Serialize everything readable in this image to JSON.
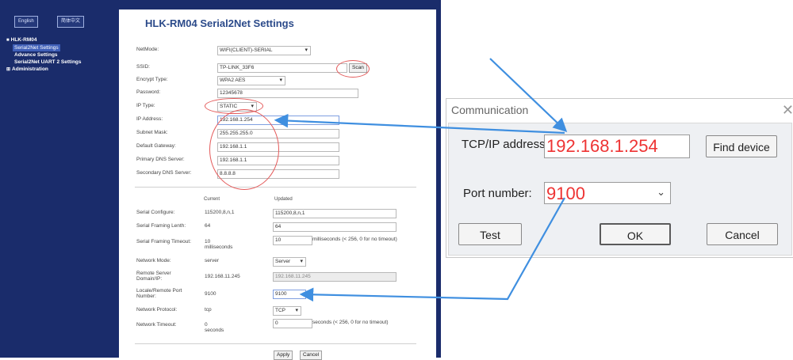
{
  "sidebar": {
    "lang_buttons": [
      "English",
      "简体中文"
    ],
    "tree_root": "HLK-RM04",
    "items": [
      {
        "label": "Serial2Net Settings",
        "selected": true
      },
      {
        "label": "Advance Settings",
        "selected": false
      },
      {
        "label": "Serial2Net UART 2 Settings",
        "selected": false
      }
    ],
    "administration": "Administration"
  },
  "settings": {
    "title": "HLK-RM04 Serial2Net Settings",
    "netmode_label": "NetMode:",
    "netmode_value": "WIFI(CLIENT)-SERIAL",
    "ssid_label": "SSID:",
    "ssid_value": "TP-LINK_33F6",
    "scan_label": "Scan",
    "encrypt_label": "Encrypt Type:",
    "encrypt_value": "WPA2 AES",
    "password_label": "Password:",
    "password_value": "12345678",
    "iptype_label": "IP Type:",
    "iptype_value": "STATIC",
    "ip_label": "IP Address:",
    "ip_value": "192.168.1.254",
    "subnet_label": "Subnet Mask:",
    "subnet_value": "255.255.255.0",
    "gateway_label": "Default Gateway:",
    "gateway_value": "192.168.1.1",
    "dns1_label": "Primary DNS Server:",
    "dns1_value": "192.168.1.1",
    "dns2_label": "Secondary DNS Server:",
    "dns2_value": "8.8.8.8",
    "col_current": "Current",
    "col_updated": "Updated",
    "serial_cfg_label": "Serial Configure:",
    "serial_cfg_current": "115200,8,n,1",
    "serial_cfg_updated": "115200,8,n,1",
    "framing_len_label": "Serial Framing Lenth:",
    "framing_len_current": "64",
    "framing_len_updated": "64",
    "framing_timeout_label": "Serial Framing Timeout:",
    "framing_timeout_current": "10 milliseconds",
    "framing_timeout_updated": "10",
    "framing_timeout_note": "milliseconds (< 256, 0 for no timeout)",
    "netmode2_label": "Network Mode:",
    "netmode2_current": "server",
    "netmode2_updated": "Server",
    "remote_label": "Remote Server Domain/IP:",
    "remote_current": "192.168.11.245",
    "remote_updated": "192.168.11.245",
    "port_label": "Locale/Remote Port Number:",
    "port_current": "9100",
    "port_updated": "9100",
    "protocol_label": "Network Protocol:",
    "protocol_current": "tcp",
    "protocol_updated": "TCP",
    "net_timeout_label": "Network Timeout:",
    "net_timeout_current": "0 seconds",
    "net_timeout_updated": "0",
    "net_timeout_note": "seconds (< 256, 0 for no timeout)",
    "apply_label": "Apply",
    "cancel_label": "Cancel"
  },
  "dialog": {
    "title": "Communication",
    "close": "✕",
    "ip_label": "TCP/IP address:",
    "ip_value": "192.168.1.254",
    "find_label": "Find device",
    "port_label": "Port number:",
    "port_value": "9100",
    "test_label": "Test",
    "ok_label": "OK",
    "cancel_label": "Cancel"
  },
  "colors": {
    "navy": "#1a2c6b",
    "title_blue": "#2b4a8a",
    "arrow_blue": "#3f8fe0",
    "highlight_red": "#e33333"
  }
}
